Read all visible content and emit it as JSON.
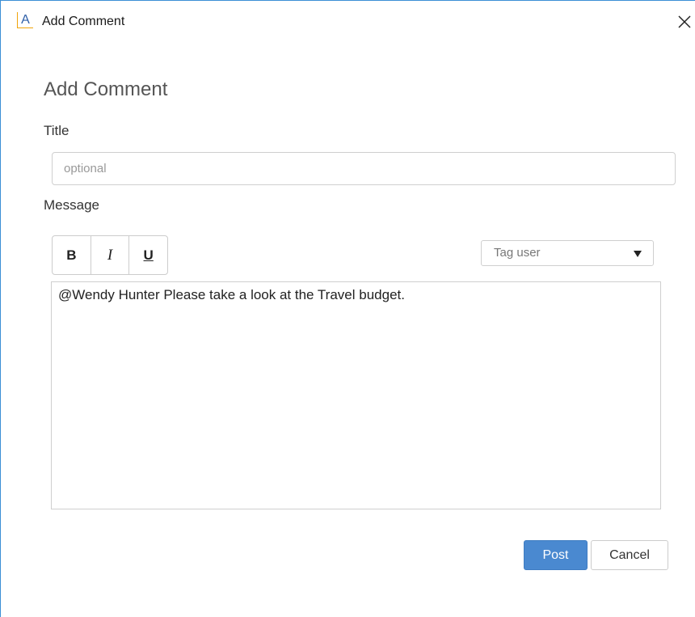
{
  "window": {
    "app_icon_glyph": "A",
    "title": "Add Comment",
    "close_icon": "close-icon"
  },
  "form": {
    "heading": "Add Comment",
    "title_label": "Title",
    "title_input": {
      "value": "",
      "placeholder": "optional"
    },
    "message_label": "Message",
    "format_buttons": {
      "bold": "B",
      "italic": "I",
      "underline": "U"
    },
    "tag_user": {
      "selected": "Tag user"
    },
    "message_text": "@Wendy Hunter Please take a look at the Travel budget."
  },
  "actions": {
    "post_label": "Post",
    "cancel_label": "Cancel"
  },
  "colors": {
    "accent": "#4a89d0",
    "window_border": "#3b8fd6",
    "icon_orange": "#f0a30a"
  }
}
